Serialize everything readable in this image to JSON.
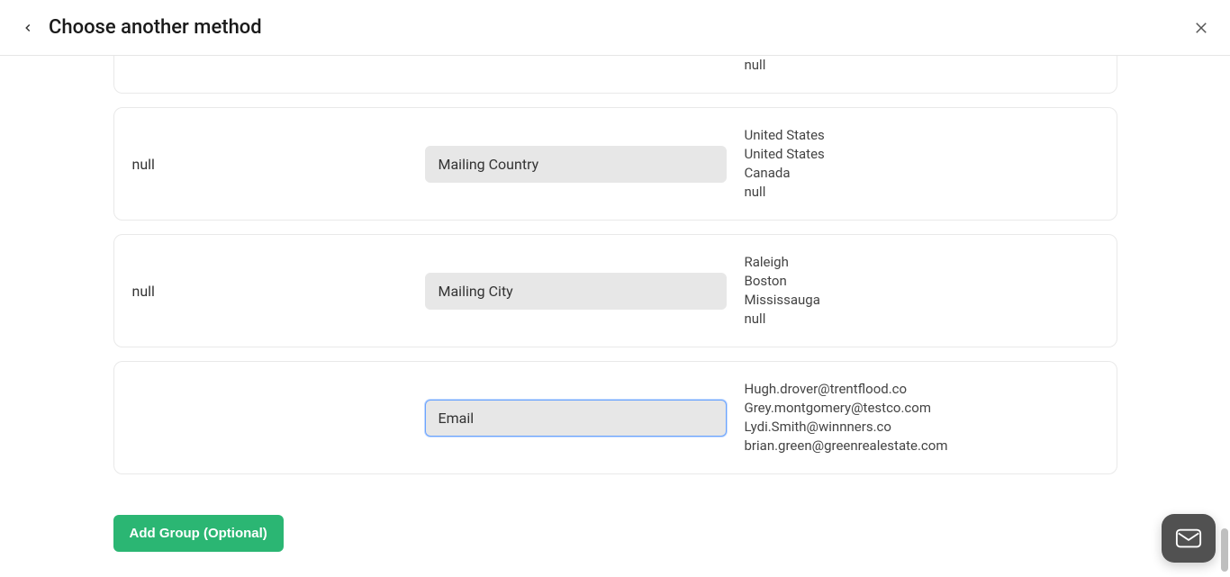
{
  "header": {
    "title": "Choose another method"
  },
  "rows": [
    {
      "left": "",
      "field": "",
      "samples": [
        "null"
      ]
    },
    {
      "left": "null",
      "field": "Mailing Country",
      "samples": [
        "United States",
        "United States",
        "Canada",
        "null"
      ]
    },
    {
      "left": "null",
      "field": "Mailing City",
      "samples": [
        "Raleigh",
        "Boston",
        "Mississauga",
        "null"
      ]
    },
    {
      "left": "",
      "field": "Email",
      "highlighted": true,
      "samples": [
        "Hugh.drover@trentflood.co",
        "Grey.montgomery@testco.com",
        "Lydi.Smith@winnners.co",
        "brian.green@greenrealestate.com"
      ]
    }
  ],
  "buttons": {
    "add_group": "Add Group (Optional)"
  }
}
